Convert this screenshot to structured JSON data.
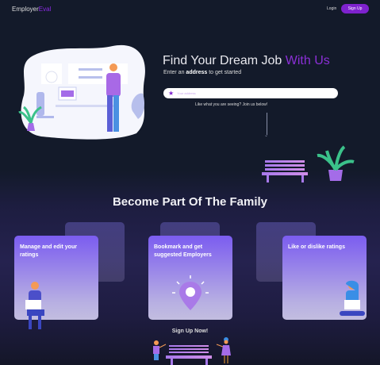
{
  "header": {
    "logo_main": "Employer",
    "logo_accent": "Eval",
    "login_label": "Login",
    "signup_label": "Sign Up"
  },
  "hero": {
    "title_main": "Find Your Dream Job ",
    "title_accent": "With Us",
    "subtitle_pre": "Enter an ",
    "subtitle_bold": "address",
    "subtitle_post": " to get started",
    "search_placeholder": "Your address",
    "prompt": "Like what you are seeing? Join us below!"
  },
  "family": {
    "title": "Become Part Of The Family",
    "cards": [
      {
        "label": "Manage and edit your ratings"
      },
      {
        "label": "Bookmark and get suggested Employers"
      },
      {
        "label": "Like or dislike ratings"
      }
    ],
    "cta": "Sign Up Now!"
  },
  "colors": {
    "accent": "#7e22ce",
    "background": "#131a2a"
  }
}
